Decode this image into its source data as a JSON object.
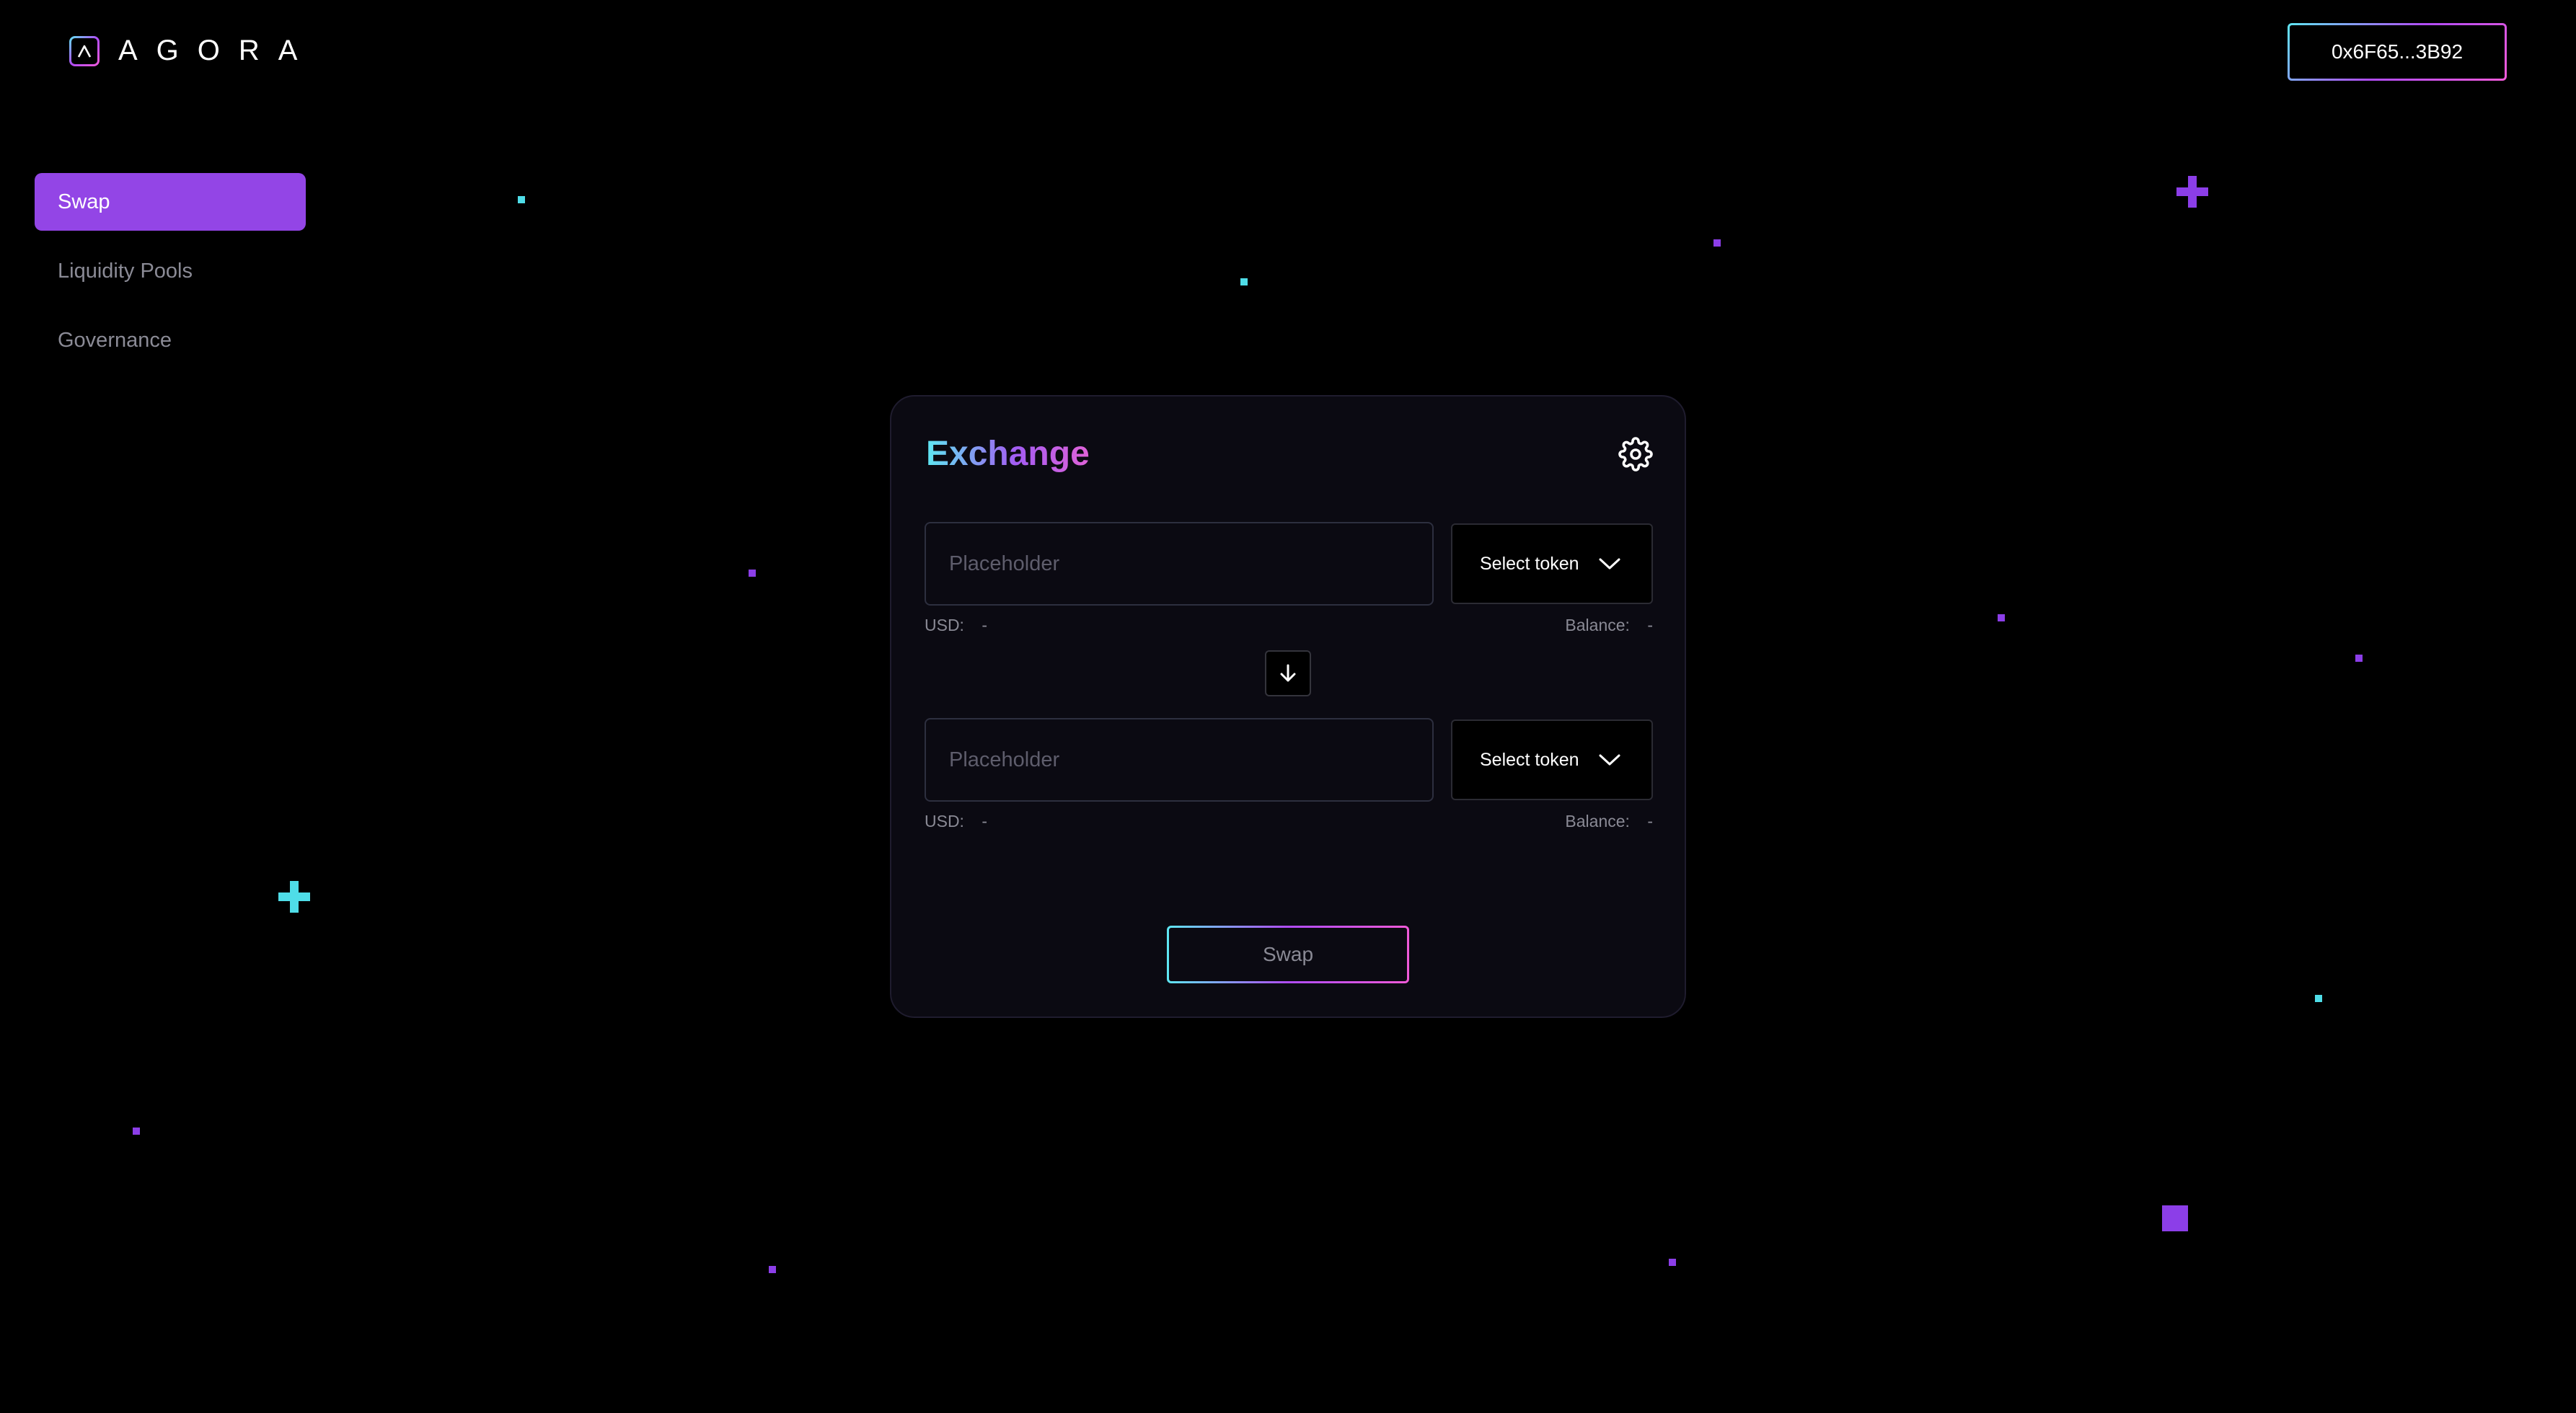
{
  "app": {
    "brand": "AGORA",
    "wallet_address": "0x6F65...3B92"
  },
  "sidebar": {
    "items": [
      {
        "label": "Swap",
        "active": true
      },
      {
        "label": "Liquidity Pools",
        "active": false
      },
      {
        "label": "Governance",
        "active": false
      }
    ]
  },
  "exchange": {
    "title": "Exchange",
    "settings_icon": "gear-icon",
    "from": {
      "placeholder": "Placeholder",
      "token_label": "Select token",
      "usd_label": "USD:",
      "usd_value": "-",
      "balance_label": "Balance:",
      "balance_value": "-"
    },
    "to": {
      "placeholder": "Placeholder",
      "token_label": "Select token",
      "usd_label": "USD:",
      "usd_value": "-",
      "balance_label": "Balance:",
      "balance_value": "-"
    },
    "flip_icon": "arrow-down-icon",
    "swap_label": "Swap"
  },
  "colors": {
    "accent": "#9345e6",
    "cyan": "#5ee7f2",
    "purple": "#8c3ee8",
    "pink": "#f05ad8",
    "background": "#000000",
    "card": "#0b0a12"
  }
}
